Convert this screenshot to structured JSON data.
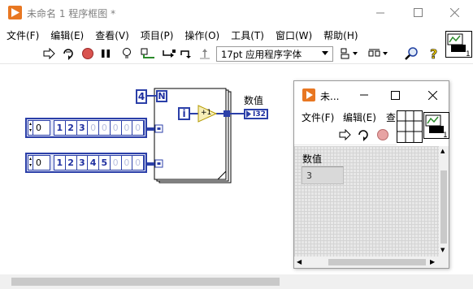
{
  "main_window": {
    "title": "未命名 1 程序框图 *",
    "menu": [
      "文件(F)",
      "编辑(E)",
      "查看(V)",
      "项目(P)",
      "操作(O)",
      "工具(T)",
      "窗口(W)",
      "帮助(H)"
    ],
    "font_select": "17pt 应用程序字体"
  },
  "diagram": {
    "n_constant": "4",
    "n_terminal": "N",
    "i_terminal": "i",
    "add_node": "+1",
    "indicator_label": "数值",
    "indicator_type": "I32",
    "array1": {
      "index": "0",
      "elements": [
        "1",
        "2",
        "3",
        "0",
        "0",
        "0",
        "0",
        "0"
      ]
    },
    "array2": {
      "index": "0",
      "elements": [
        "1",
        "2",
        "3",
        "4",
        "5",
        "0",
        "0",
        "0"
      ]
    }
  },
  "front_panel": {
    "title": "未...",
    "menu": [
      "文件(F)",
      "编辑(E)",
      "查"
    ],
    "indicator_label": "数值",
    "indicator_value": "3"
  },
  "colors": {
    "accent_orange": "#e87722",
    "wire_blue": "#2b3fa8",
    "stop_red": "#d9534f"
  }
}
